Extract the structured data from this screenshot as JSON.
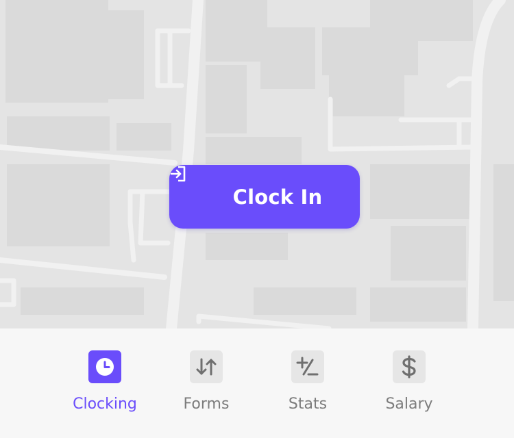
{
  "clock_button": {
    "label": "Clock In",
    "icon": "login-icon"
  },
  "tabs": [
    {
      "label": "Clocking",
      "icon": "clock-icon",
      "active": true
    },
    {
      "label": "Forms",
      "icon": "sort-arrows-icon",
      "active": false
    },
    {
      "label": "Stats",
      "icon": "plus-minus-icon",
      "active": false
    },
    {
      "label": "Salary",
      "icon": "dollar-icon",
      "active": false
    }
  ],
  "colors": {
    "accent": "#6a4dfb",
    "inactive": "#7c7c7c",
    "tab_bg": "#f7f7f7",
    "map_bg": "#e4e4e4"
  }
}
